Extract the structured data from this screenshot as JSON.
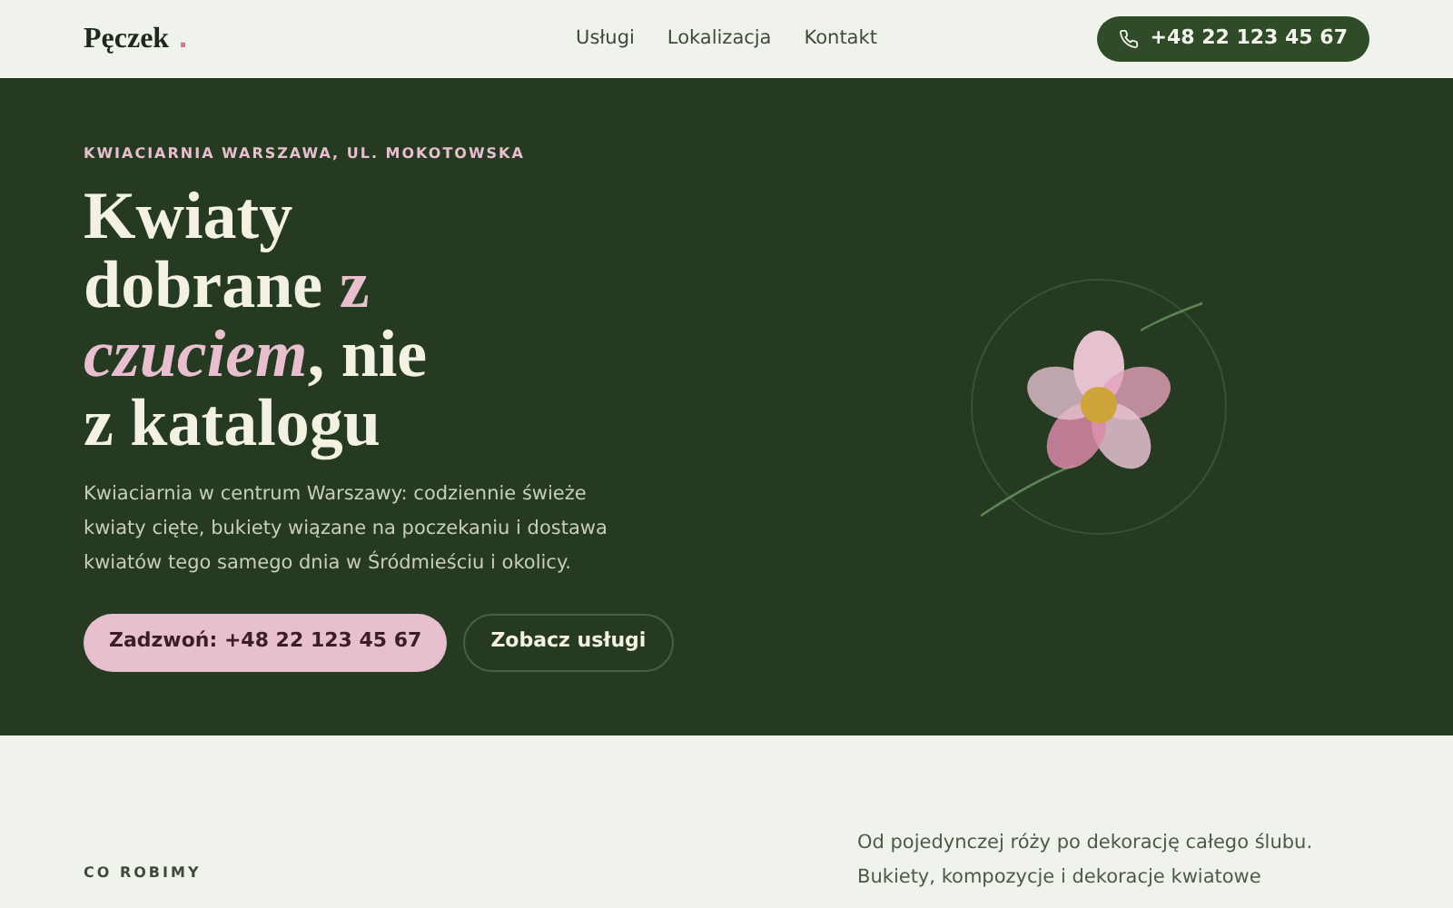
{
  "header": {
    "logo": "Pęczek",
    "logo_dot": ".",
    "nav": [
      {
        "label": "Usługi"
      },
      {
        "label": "Lokalizacja"
      },
      {
        "label": "Kontakt"
      }
    ],
    "phone_button": "+48 22 123 45 67"
  },
  "hero": {
    "eyebrow": "KWIACIARNIA WARSZAWA, UL. MOKOTOWSKA",
    "title": [
      {
        "kind": "plain",
        "text": "Kwiaty dobrane "
      },
      {
        "kind": "accent",
        "text": "z "
      },
      {
        "kind": "accent_italic",
        "text": "czuciem"
      },
      {
        "kind": "plain",
        "text": ", nie z katalogu"
      }
    ],
    "lead": "Kwiaciarnia w centrum Warszawy: codziennie świeże kwiaty cięte, bukiety wiązane na poczekaniu i dostawa kwiatów tego samego dnia w Śródmieściu i okolicy.",
    "primary_button": "Zadzwoń: +48 22 123 45 67",
    "secondary_button": "Zobacz usługi"
  },
  "services": {
    "eyebrow": "CO ROBIMY",
    "text": "Od pojedynczej róży po dekorację całego ślubu. Bukiety, kompozycje i dekoracje kwiatowe"
  }
}
